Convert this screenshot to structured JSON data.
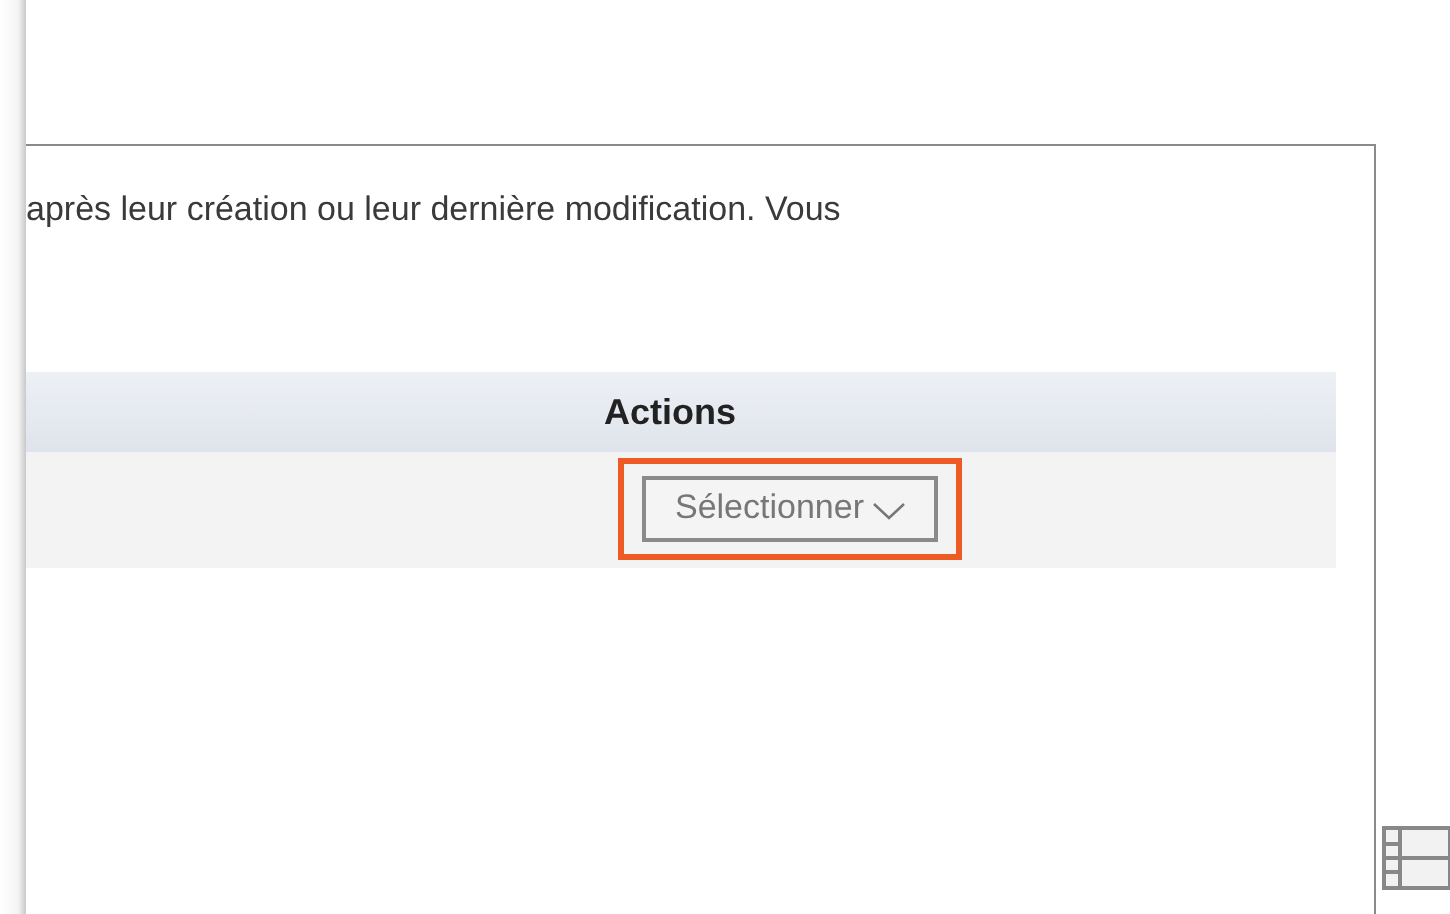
{
  "description": "après leur création ou leur dernière modification. Vous",
  "table": {
    "columns": [
      "Actions"
    ],
    "rows": [
      {
        "action_button": {
          "label": "Sélectionner",
          "highlighted": true
        }
      }
    ]
  }
}
